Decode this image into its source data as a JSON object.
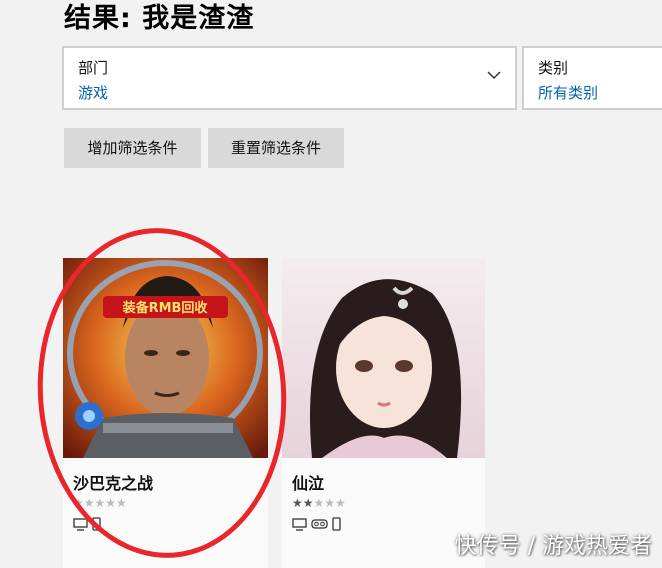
{
  "header": {
    "title": "结果: 我是渣渣"
  },
  "filters": {
    "department": {
      "label": "部门",
      "value": "游戏"
    },
    "category": {
      "label": "类别",
      "value": "所有类别"
    }
  },
  "buttons": {
    "add_filter": "增加筛选条件",
    "reset_filter": "重置筛选条件"
  },
  "apps": [
    {
      "name": "沙巴克之战",
      "art_banner": "装备RMB回收",
      "rating_stars": 5,
      "rating_filled": 0,
      "platforms": [
        "pc-icon",
        "mobile-icon"
      ]
    },
    {
      "name": "仙泣",
      "rating_stars": 5,
      "rating_filled": 2.5,
      "platforms": [
        "pc-icon",
        "vr-headset-icon",
        "mobile-icon"
      ]
    }
  ],
  "annotation": {
    "color": "#e8262b"
  },
  "watermark": "快传号 / 游戏热爱者",
  "colors": {
    "accent": "#0063b1",
    "background": "#f2f2f2"
  }
}
